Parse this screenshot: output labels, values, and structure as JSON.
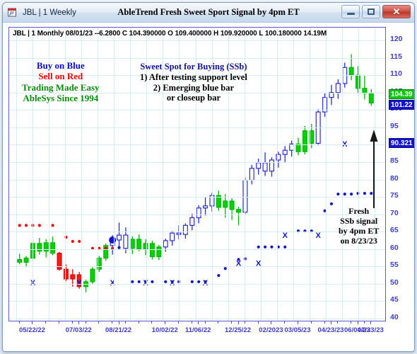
{
  "window": {
    "title_left": "JBL | 1 Weekly",
    "title_center": "AbleTrend Fresh Sweet Sport Signal by 4pm ET",
    "minimize_label": "",
    "maximize_label": "",
    "close_label": "✕"
  },
  "quote": {
    "line": "JBL | 1 Monthly 08/01/23 --6.2800 C 104.390000 O 109.400000 H 109.920000 L 100.180000 14.19M",
    "symbol": "JBL",
    "interval": "1 Monthly",
    "date": "08/01/23",
    "change": "--6.2800",
    "close": "104.390000",
    "open": "109.400000",
    "high": "109.920000",
    "low": "100.180000",
    "volume": "14.19M"
  },
  "annotations": {
    "left": {
      "line1": "Buy on Blue",
      "line2": "Sell on Red",
      "line3": "Trading Made Easy",
      "line4": "AbleSys Since 1994",
      "color1": "#0a0ad0",
      "color2": "#ee0000",
      "color3": "#0a8a0a"
    },
    "middle": {
      "title": "Sweet Spot for Buying (SSb)",
      "item1": "1) After testing support level",
      "item2": "2) Emerging blue bar",
      "item3": "or closeup bar",
      "color": "#12128f"
    },
    "right": {
      "line1": "Fresh",
      "line2": "SSb signal",
      "line3": "by 4pm ET",
      "line4": "on 8/23/23",
      "color": "#000000"
    }
  },
  "chart_data": {
    "type": "candlestick",
    "title": "AbleTrend Fresh Sweet Sport Signal by 4pm ET",
    "symbol": "JBL",
    "timeframe": "1 Weekly",
    "ylabel": "",
    "xlabel": "",
    "ylim": [
      40,
      120
    ],
    "grid": true,
    "y_ticks": [
      120,
      115,
      110,
      105,
      100,
      95,
      90,
      85,
      80,
      75,
      70,
      65,
      60,
      55,
      50,
      45,
      40
    ],
    "y_tick_labels": [
      "120",
      "115",
      "110",
      "105",
      "100",
      "95",
      "90",
      "85",
      "80",
      "75",
      "70",
      "65",
      "60",
      "55",
      "50",
      "45",
      "40"
    ],
    "price_badges": [
      {
        "value": "104.39",
        "color": "#13c413",
        "kind": "close"
      },
      {
        "value": "101.22",
        "color": "#1414c8",
        "kind": "last"
      },
      {
        "value": "90.321",
        "color": "#1414c8",
        "kind": "stop"
      }
    ],
    "x_tick_labels": [
      "05/22/22",
      "07/03/22",
      "08/21/22",
      "10/02/22",
      "11/06/22",
      "12/25/22",
      "02/2023",
      "03/05/23",
      "04/23/23",
      "06/04/23",
      "07/23/23"
    ],
    "legend": [],
    "series": [
      {
        "name": "JBL weekly OHLC",
        "bars": [
          {
            "i": 0,
            "o": 57.0,
            "h": 58.6,
            "l": 55.6,
            "c": 56.2,
            "color": "green"
          },
          {
            "i": 1,
            "o": 56.2,
            "h": 58.0,
            "l": 54.8,
            "c": 57.4,
            "color": "green"
          },
          {
            "i": 2,
            "o": 57.4,
            "h": 62.4,
            "l": 56.6,
            "c": 61.6,
            "color": "green"
          },
          {
            "i": 3,
            "o": 61.6,
            "h": 63.2,
            "l": 58.4,
            "c": 59.4,
            "color": "green"
          },
          {
            "i": 4,
            "o": 59.4,
            "h": 62.8,
            "l": 57.6,
            "c": 61.8,
            "color": "green"
          },
          {
            "i": 5,
            "o": 61.8,
            "h": 63.6,
            "l": 58.2,
            "c": 58.8,
            "color": "green"
          },
          {
            "i": 6,
            "o": 58.8,
            "h": 59.2,
            "l": 53.8,
            "c": 54.2,
            "color": "red"
          },
          {
            "i": 7,
            "o": 54.2,
            "h": 55.6,
            "l": 50.8,
            "c": 51.4,
            "color": "red"
          },
          {
            "i": 8,
            "o": 51.4,
            "h": 54.2,
            "l": 49.2,
            "c": 52.6,
            "color": "red"
          },
          {
            "i": 9,
            "o": 52.6,
            "h": 53.4,
            "l": 48.6,
            "c": 49.2,
            "color": "red"
          },
          {
            "i": 10,
            "o": 49.2,
            "h": 51.2,
            "l": 47.6,
            "c": 50.6,
            "color": "green"
          },
          {
            "i": 11,
            "o": 50.6,
            "h": 54.8,
            "l": 50.0,
            "c": 54.2,
            "color": "green"
          },
          {
            "i": 12,
            "o": 54.2,
            "h": 58.0,
            "l": 53.4,
            "c": 57.4,
            "color": "green"
          },
          {
            "i": 13,
            "o": 57.4,
            "h": 61.6,
            "l": 56.6,
            "c": 61.0,
            "color": "green"
          },
          {
            "i": 14,
            "o": 61.0,
            "h": 64.0,
            "l": 58.4,
            "c": 62.6,
            "color": "blue"
          },
          {
            "i": 15,
            "o": 62.6,
            "h": 67.6,
            "l": 60.2,
            "c": 64.0,
            "color": "blue"
          },
          {
            "i": 16,
            "o": 64.0,
            "h": 66.2,
            "l": 58.8,
            "c": 60.2,
            "color": "blue"
          },
          {
            "i": 17,
            "o": 60.2,
            "h": 63.6,
            "l": 58.6,
            "c": 62.8,
            "color": "green"
          },
          {
            "i": 18,
            "o": 62.8,
            "h": 64.2,
            "l": 59.4,
            "c": 60.0,
            "color": "green"
          },
          {
            "i": 19,
            "o": 60.0,
            "h": 62.8,
            "l": 58.2,
            "c": 61.6,
            "color": "green"
          },
          {
            "i": 20,
            "o": 61.6,
            "h": 62.4,
            "l": 57.0,
            "c": 57.8,
            "color": "green"
          },
          {
            "i": 21,
            "o": 57.8,
            "h": 61.2,
            "l": 56.8,
            "c": 60.6,
            "color": "green"
          },
          {
            "i": 22,
            "o": 60.6,
            "h": 63.0,
            "l": 59.2,
            "c": 62.4,
            "color": "blue"
          },
          {
            "i": 23,
            "o": 62.4,
            "h": 65.2,
            "l": 61.0,
            "c": 64.6,
            "color": "blue"
          },
          {
            "i": 24,
            "o": 64.6,
            "h": 66.8,
            "l": 62.8,
            "c": 64.2,
            "color": "blue"
          },
          {
            "i": 25,
            "o": 64.2,
            "h": 67.4,
            "l": 63.0,
            "c": 66.8,
            "color": "blue"
          },
          {
            "i": 26,
            "o": 66.8,
            "h": 70.2,
            "l": 65.4,
            "c": 69.0,
            "color": "blue"
          },
          {
            "i": 27,
            "o": 69.0,
            "h": 72.6,
            "l": 67.4,
            "c": 71.8,
            "color": "blue"
          },
          {
            "i": 28,
            "o": 71.8,
            "h": 74.8,
            "l": 69.6,
            "c": 72.4,
            "color": "blue"
          },
          {
            "i": 29,
            "o": 72.4,
            "h": 76.2,
            "l": 70.8,
            "c": 75.4,
            "color": "blue"
          },
          {
            "i": 30,
            "o": 75.4,
            "h": 76.8,
            "l": 71.0,
            "c": 72.0,
            "color": "green"
          },
          {
            "i": 31,
            "o": 72.0,
            "h": 75.8,
            "l": 69.0,
            "c": 73.8,
            "color": "green"
          },
          {
            "i": 32,
            "o": 73.8,
            "h": 74.6,
            "l": 68.4,
            "c": 71.4,
            "color": "green"
          },
          {
            "i": 33,
            "o": 71.4,
            "h": 72.2,
            "l": 66.8,
            "c": 70.6,
            "color": "green"
          },
          {
            "i": 34,
            "o": 70.6,
            "h": 80.6,
            "l": 70.0,
            "c": 79.8,
            "color": "blue"
          },
          {
            "i": 35,
            "o": 79.8,
            "h": 84.2,
            "l": 78.6,
            "c": 83.2,
            "color": "blue"
          },
          {
            "i": 36,
            "o": 83.2,
            "h": 86.0,
            "l": 81.4,
            "c": 84.8,
            "color": "blue"
          },
          {
            "i": 37,
            "o": 84.8,
            "h": 87.8,
            "l": 81.0,
            "c": 82.4,
            "color": "blue"
          },
          {
            "i": 38,
            "o": 82.4,
            "h": 86.4,
            "l": 80.8,
            "c": 85.6,
            "color": "blue"
          },
          {
            "i": 39,
            "o": 85.6,
            "h": 88.0,
            "l": 83.4,
            "c": 87.2,
            "color": "blue"
          },
          {
            "i": 40,
            "o": 87.2,
            "h": 89.6,
            "l": 85.0,
            "c": 88.4,
            "color": "blue"
          },
          {
            "i": 41,
            "o": 88.4,
            "h": 91.2,
            "l": 86.6,
            "c": 90.2,
            "color": "blue"
          },
          {
            "i": 42,
            "o": 90.2,
            "h": 92.0,
            "l": 87.0,
            "c": 88.0,
            "color": "green"
          },
          {
            "i": 43,
            "o": 88.0,
            "h": 95.4,
            "l": 87.2,
            "c": 94.0,
            "color": "green"
          },
          {
            "i": 44,
            "o": 94.0,
            "h": 96.0,
            "l": 89.0,
            "c": 90.4,
            "color": "green"
          },
          {
            "i": 45,
            "o": 90.4,
            "h": 100.2,
            "l": 89.8,
            "c": 99.4,
            "color": "blue"
          },
          {
            "i": 46,
            "o": 99.4,
            "h": 104.8,
            "l": 98.0,
            "c": 103.6,
            "color": "blue"
          },
          {
            "i": 47,
            "o": 103.6,
            "h": 107.2,
            "l": 101.4,
            "c": 105.0,
            "color": "blue"
          },
          {
            "i": 48,
            "o": 105.0,
            "h": 108.8,
            "l": 103.2,
            "c": 107.6,
            "color": "blue"
          },
          {
            "i": 49,
            "o": 107.6,
            "h": 113.6,
            "l": 106.4,
            "c": 112.2,
            "color": "blue"
          },
          {
            "i": 50,
            "o": 112.2,
            "h": 116.0,
            "l": 108.6,
            "c": 110.0,
            "color": "green"
          },
          {
            "i": 51,
            "o": 110.0,
            "h": 112.6,
            "l": 104.8,
            "c": 106.2,
            "color": "green"
          },
          {
            "i": 52,
            "o": 106.2,
            "h": 110.0,
            "l": 103.0,
            "c": 104.8,
            "color": "green"
          },
          {
            "i": 53,
            "o": 104.8,
            "h": 106.0,
            "l": 101.2,
            "c": 102.0,
            "color": "green"
          }
        ]
      }
    ],
    "stop_dots": {
      "name": "AbleTrend stop dots",
      "red_color": "#ee0000",
      "blue_color": "#1414c8",
      "points": [
        {
          "i": 0,
          "y": 66.8,
          "color": "red"
        },
        {
          "i": 1,
          "y": 66.8,
          "color": "red"
        },
        {
          "i": 2,
          "y": 66.8,
          "color": "red"
        },
        {
          "i": 3,
          "y": 66.8,
          "color": "red"
        },
        {
          "i": 5,
          "y": 66.8,
          "color": "red"
        },
        {
          "i": 7,
          "y": 63.4,
          "color": "red"
        },
        {
          "i": 8,
          "y": 62.2,
          "color": "red"
        },
        {
          "i": 9,
          "y": 62.2,
          "color": "red"
        },
        {
          "i": 11,
          "y": 60.2,
          "color": "red"
        },
        {
          "i": 12,
          "y": 60.2,
          "color": "red"
        },
        {
          "i": 13,
          "y": 60.2,
          "color": "red"
        },
        {
          "i": 14,
          "y": 60.2,
          "color": "red"
        },
        {
          "i": 15,
          "y": 60.4,
          "color": "blue"
        },
        {
          "i": 17,
          "y": 50.6,
          "color": "blue"
        },
        {
          "i": 18,
          "y": 50.6,
          "color": "blue"
        },
        {
          "i": 19,
          "y": 50.6,
          "color": "blue"
        },
        {
          "i": 20,
          "y": 50.6,
          "color": "blue"
        },
        {
          "i": 22,
          "y": 50.6,
          "color": "blue"
        },
        {
          "i": 23,
          "y": 50.6,
          "color": "blue"
        },
        {
          "i": 24,
          "y": 50.6,
          "color": "blue"
        },
        {
          "i": 26,
          "y": 50.6,
          "color": "blue"
        },
        {
          "i": 27,
          "y": 50.6,
          "color": "blue"
        },
        {
          "i": 28,
          "y": 50.6,
          "color": "blue"
        },
        {
          "i": 30,
          "y": 52.4,
          "color": "blue"
        },
        {
          "i": 31,
          "y": 54.4,
          "color": "blue"
        },
        {
          "i": 33,
          "y": 57.0,
          "color": "blue"
        },
        {
          "i": 34,
          "y": 57.2,
          "color": "blue"
        },
        {
          "i": 36,
          "y": 60.6,
          "color": "blue"
        },
        {
          "i": 37,
          "y": 60.6,
          "color": "blue"
        },
        {
          "i": 38,
          "y": 60.6,
          "color": "blue"
        },
        {
          "i": 39,
          "y": 60.6,
          "color": "blue"
        },
        {
          "i": 40,
          "y": 60.6,
          "color": "blue"
        },
        {
          "i": 42,
          "y": 65.2,
          "color": "blue"
        },
        {
          "i": 43,
          "y": 65.2,
          "color": "blue"
        },
        {
          "i": 44,
          "y": 65.2,
          "color": "blue"
        },
        {
          "i": 46,
          "y": 71.0,
          "color": "blue"
        },
        {
          "i": 47,
          "y": 73.0,
          "color": "blue"
        },
        {
          "i": 48,
          "y": 75.8,
          "color": "blue"
        },
        {
          "i": 49,
          "y": 75.8,
          "color": "blue"
        },
        {
          "i": 50,
          "y": 75.8,
          "color": "blue"
        },
        {
          "i": 51,
          "y": 76.0,
          "color": "blue"
        },
        {
          "i": 52,
          "y": 76.0,
          "color": "blue"
        },
        {
          "i": 53,
          "y": 76.0,
          "color": "blue"
        }
      ]
    },
    "signal_markers": {
      "name": "SSb X markers",
      "symbol": "X",
      "color": "#1414c8",
      "points": [
        {
          "i": 2,
          "y": 50.4
        },
        {
          "i": 9,
          "y": 50.4
        },
        {
          "i": 14,
          "y": 50.4
        },
        {
          "i": 19,
          "y": 50.4
        },
        {
          "i": 23,
          "y": 50.4
        },
        {
          "i": 28,
          "y": 50.4
        },
        {
          "i": 33,
          "y": 56.0
        },
        {
          "i": 36,
          "y": 56.0
        },
        {
          "i": 40,
          "y": 64.0
        },
        {
          "i": 45,
          "y": 64.0
        },
        {
          "i": 49,
          "y": 90.3
        }
      ]
    },
    "highlight_dot": {
      "i": 14,
      "y": 62.6,
      "color": "#1414c8",
      "radius": 5
    },
    "arrow": {
      "from_i": 49,
      "from_y": 62.0,
      "to_y": 92.0,
      "color": "#1a1a1a"
    }
  },
  "axis_colors": {
    "tick_text": "#3b3bc8",
    "grid": "#d6ecf5",
    "frame": "#5a5ad0"
  }
}
